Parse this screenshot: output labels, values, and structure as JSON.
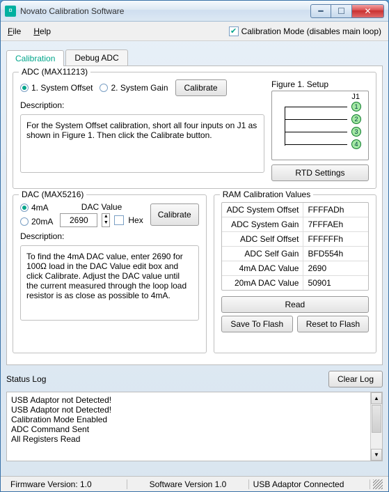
{
  "window": {
    "title": "Novato Calibration Software"
  },
  "menubar": {
    "file": "File",
    "help": "Help",
    "cal_mode_label": "Calibration Mode (disables main loop)",
    "cal_mode_checked": true
  },
  "tabs": {
    "calibration": "Calibration",
    "debug": "Debug ADC"
  },
  "adc": {
    "title": "ADC (MAX11213)",
    "opt1": "1. System Offset",
    "opt2": "2. System Gain",
    "calibrate": "Calibrate",
    "desc_label": "Description:",
    "desc": "For the System Offset calibration, short all four inputs on J1 as shown in Figure 1. Then click the Calibrate button.",
    "figure_title": "Figure 1. Setup",
    "j1": "J1",
    "rtd_settings": "RTD Settings"
  },
  "dac": {
    "title": "DAC (MAX5216)",
    "opt4ma": "4mA",
    "opt20ma": "20mA",
    "dacvalue_label": "DAC Value",
    "dacvalue": "2690",
    "hex": "Hex",
    "calibrate": "Calibrate",
    "desc_label": "Description:",
    "desc": "To find the 4mA DAC value, enter 2690 for 100Ω load in the DAC Value edit box and click Calibrate. Adjust the DAC value until the current measured through the loop load resistor is as close as possible to 4mA."
  },
  "ram": {
    "title": "RAM Calibration Values",
    "rows": [
      {
        "k": "ADC System Offset",
        "v": "FFFFADh"
      },
      {
        "k": "ADC System Gain",
        "v": "7FFFAEh"
      },
      {
        "k": "ADC Self Offset",
        "v": "FFFFFFh"
      },
      {
        "k": "ADC Self Gain",
        "v": "BFD554h"
      },
      {
        "k": "4mA DAC Value",
        "v": "2690"
      },
      {
        "k": "20mA DAC Value",
        "v": "50901"
      }
    ],
    "read": "Read",
    "save": "Save To Flash",
    "reset": "Reset to Flash"
  },
  "log": {
    "title": "Status Log",
    "clear": "Clear Log",
    "lines": "USB Adaptor not Detected!\nUSB Adaptor not Detected!\nCalibration Mode Enabled\nADC Command Sent\nAll Registers Read"
  },
  "statusbar": {
    "fw": "Firmware Version: 1.0",
    "sw": "Software Version 1.0",
    "usb": "USB Adaptor Connected"
  }
}
